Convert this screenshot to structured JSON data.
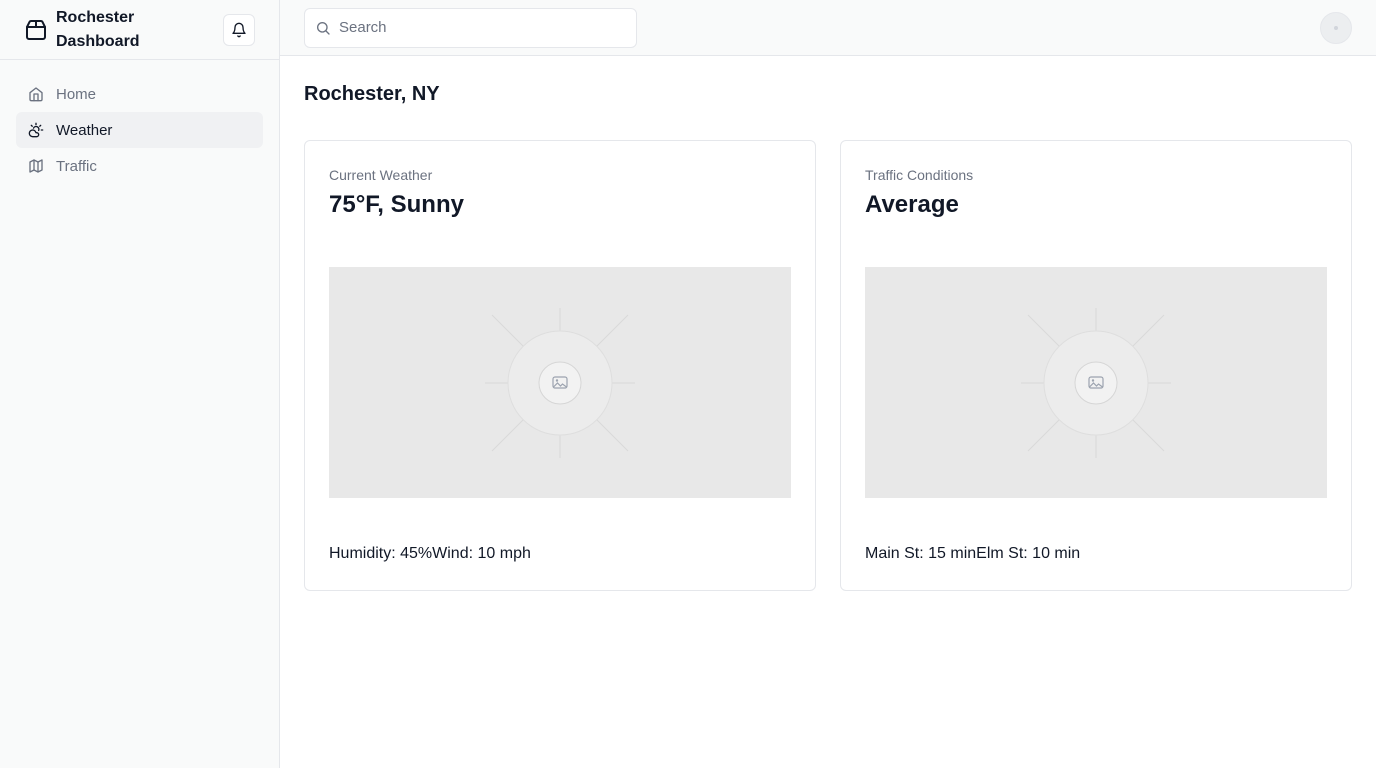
{
  "app": {
    "title": "Rochester Dashboard"
  },
  "sidebar": {
    "items": [
      {
        "label": "Home",
        "icon": "home-icon"
      },
      {
        "label": "Weather",
        "icon": "weather-icon",
        "active": true
      },
      {
        "label": "Traffic",
        "icon": "map-icon"
      }
    ]
  },
  "search": {
    "placeholder": "Search",
    "value": ""
  },
  "page": {
    "title": "Rochester, NY"
  },
  "cards": [
    {
      "label": "Current Weather",
      "value": "75°F, Sunny",
      "footer": "Humidity: 45%Wind: 10 mph"
    },
    {
      "label": "Traffic Conditions",
      "value": "Average",
      "footer": "Main St: 15 minElm St: 10 min"
    }
  ],
  "colors": {
    "sidebar_bg": "#f9fafa",
    "border": "#e5e7eb",
    "active_bg": "#f0f1f3",
    "muted_text": "#6b7280",
    "placeholder_bg": "#e8e8e8"
  }
}
